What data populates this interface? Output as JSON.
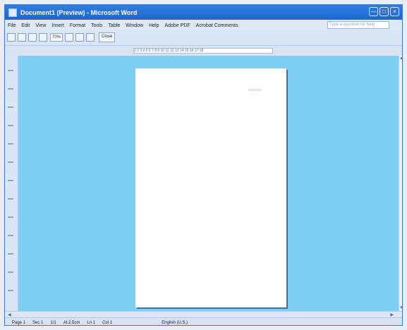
{
  "window": {
    "title": "Document1 (Preview) - Microsoft Word",
    "controls": [
      "—",
      "□",
      "×"
    ]
  },
  "menubar": {
    "items": [
      "File",
      "Edit",
      "View",
      "Insert",
      "Format",
      "Tools",
      "Table",
      "Window",
      "Help",
      "Adobe PDF",
      "Acrobat Comments"
    ],
    "ask_placeholder": "Type a question for help"
  },
  "toolbar": {
    "zoom": "70%",
    "close_label": "Close"
  },
  "ruler": {
    "labels": "1 2 3 4 5 6 7 8 9 10 11 12 13 14 15 16 17 18"
  },
  "statusbar": {
    "page": "Page 1",
    "section": "Sec 1",
    "page_of": "1/1",
    "at": "At 2.5cm",
    "line": "Ln 1",
    "col": "Col 1",
    "language": "English (U.S.)"
  },
  "icons": {
    "up": "▲",
    "down": "▼",
    "left": "◀",
    "right": "▶"
  }
}
